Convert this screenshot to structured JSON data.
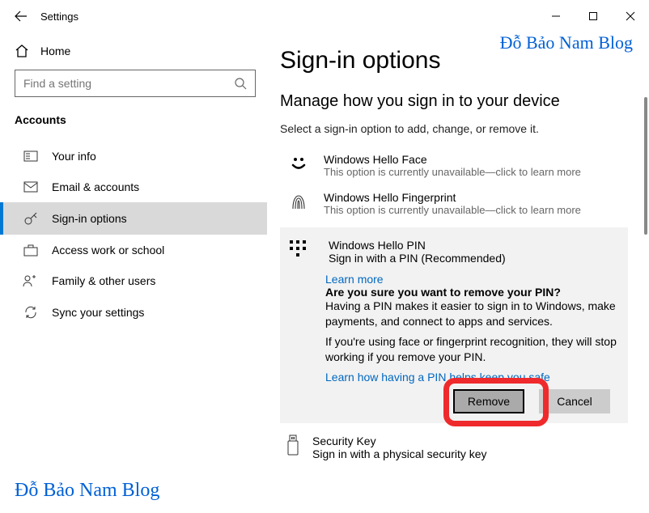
{
  "window": {
    "title": "Settings",
    "min": "Minimize",
    "max": "Maximize",
    "close": "Close"
  },
  "watermark": "Đỗ Bảo Nam Blog",
  "sidebar": {
    "home": "Home",
    "search_placeholder": "Find a setting",
    "section": "Accounts",
    "items": [
      {
        "label": "Your info"
      },
      {
        "label": "Email & accounts"
      },
      {
        "label": "Sign-in options"
      },
      {
        "label": "Access work or school"
      },
      {
        "label": "Family & other users"
      },
      {
        "label": "Sync your settings"
      }
    ]
  },
  "page": {
    "title": "Sign-in options",
    "subhead": "Manage how you sign in to your device",
    "desc": "Select a sign-in option to add, change, or remove it.",
    "options": {
      "face": {
        "title": "Windows Hello Face",
        "sub": "This option is currently unavailable—click to learn more"
      },
      "finger": {
        "title": "Windows Hello Fingerprint",
        "sub": "This option is currently unavailable—click to learn more"
      },
      "pin": {
        "title": "Windows Hello PIN",
        "sub": "Sign in with a PIN (Recommended)",
        "learn": "Learn more",
        "confirm": "Are you sure you want to remove your PIN?",
        "p1": "Having a PIN makes it easier to sign in to Windows, make payments, and connect to apps and services.",
        "p2": "If you're using face or fingerprint recognition, they will stop working if you remove your PIN.",
        "link2": "Learn how having a PIN helps keep you safe",
        "remove": "Remove",
        "cancel": "Cancel"
      },
      "seckey": {
        "title": "Security Key",
        "sub": "Sign in with a physical security key"
      }
    }
  }
}
